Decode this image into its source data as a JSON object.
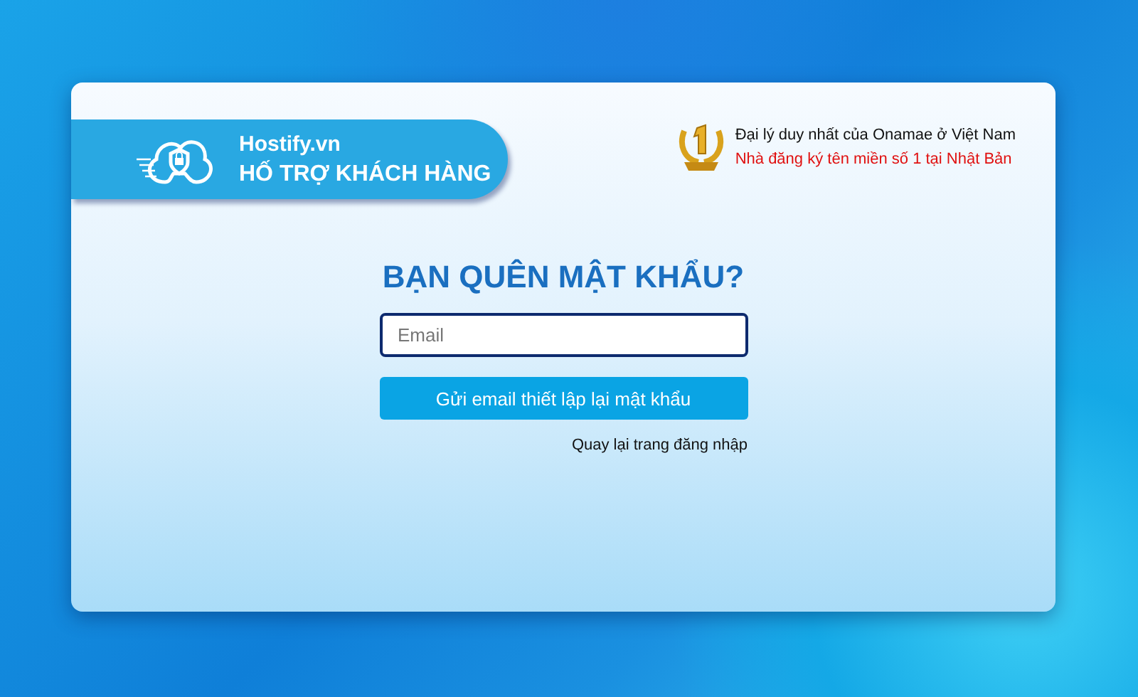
{
  "brand": {
    "name": "Hostify.vn",
    "subtitle": "HỐ TRỢ KHÁCH HÀNG"
  },
  "award": {
    "line_1": "Đại lý duy nhất của Onamae ở Việt Nam",
    "line_2": "Nhà đăng ký tên miền số 1 tại Nhật Bản"
  },
  "form": {
    "title": "BẠN QUÊN MẬT KHẨU?",
    "email": {
      "placeholder": "Email"
    },
    "submit": "Gửi email thiết lập lại mật khẩu",
    "back_link": "Quay lại trang đăng nhập"
  }
}
